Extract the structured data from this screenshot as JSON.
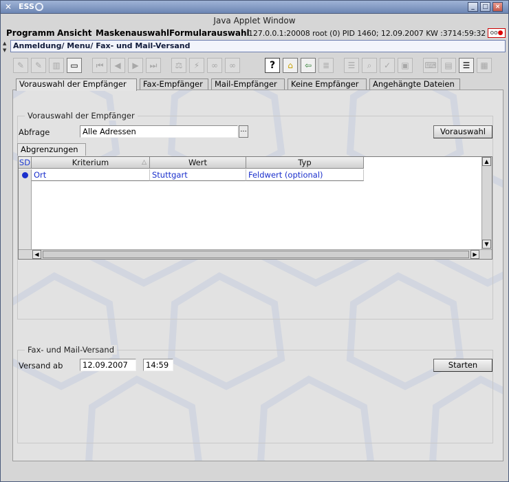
{
  "window": {
    "app_name": "ESS",
    "buttons": {
      "minimize": "_",
      "maximize": "□",
      "close": "×"
    }
  },
  "applet_title": "Java Applet Window",
  "menu": {
    "items": [
      "Programm",
      "Ansicht",
      "Maskenauswahl",
      "Formularauswahl"
    ],
    "status": "127.0.0.1:20008 root (0) PID 1460; 12.09.2007 KW :3714:59:32",
    "indicator": "oo"
  },
  "breadcrumb": "Anmeldung/ Menu/ Fax- und Mail-Versand",
  "toolbar_icons": [
    "edit-doc-icon",
    "edit-doc2-icon",
    "columns-icon",
    "blank-page-icon",
    "first-record-icon",
    "previous-record-icon",
    "next-record-icon",
    "last-record-icon",
    "filter-icon",
    "lightning-icon",
    "link-icon",
    "link2-icon",
    "help-icon",
    "home-icon",
    "exit-door-icon",
    "list-arrow-icon",
    "document-lines-icon",
    "search-icon",
    "check-icon",
    "stamp-icon",
    "keyboard-icon",
    "card-icon",
    "bars-icon",
    "sheet-icon"
  ],
  "tabs": [
    "Vorauswahl der Empfänger",
    "Fax-Empfänger",
    "Mail-Empfänger",
    "Keine Empfänger",
    "Angehängte Dateien"
  ],
  "vorauswahl": {
    "group_title": "Vorauswahl der Empfänger",
    "abfrage_label": "Abfrage",
    "abfrage_value": "Alle Adressen",
    "dots": "...",
    "vorauswahl_button": "Vorauswahl",
    "subtab": "Abgrenzungen",
    "columns": [
      "SD",
      "Kriterium",
      "Wert",
      "Typ"
    ],
    "rows": [
      {
        "kriterium": "Ort",
        "wert": "Stuttgart",
        "typ": "Feldwert (optional)"
      }
    ]
  },
  "versand": {
    "group_title": "Fax- und Mail-Versand",
    "versand_label": "Versand ab",
    "date": "12.09.2007",
    "time": "14:59",
    "start_button": "Starten"
  },
  "colors": {
    "titlebar": "#7f96c2",
    "accent_text": "#1a2fcc",
    "breadcrumb_border": "#6e7fb0"
  }
}
